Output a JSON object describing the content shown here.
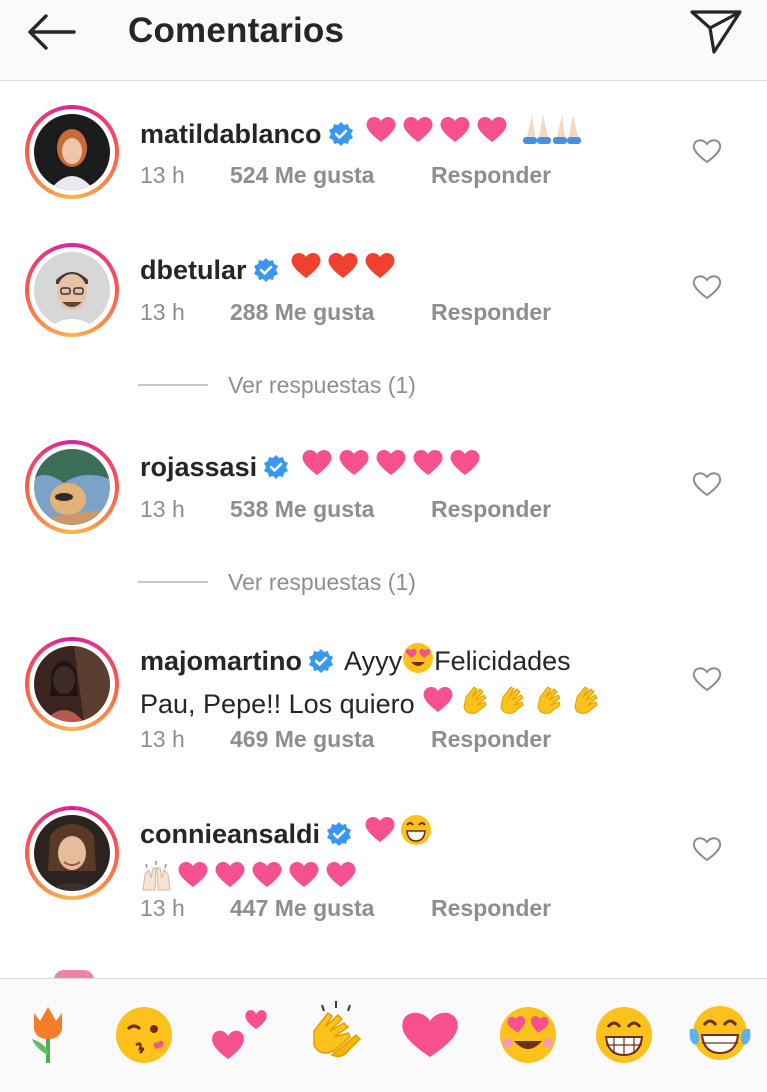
{
  "header": {
    "title": "Comentarios"
  },
  "comments": [
    {
      "username": "matildablanco",
      "verified": true,
      "text": "",
      "emojis": [
        "pink-heart",
        "pink-heart",
        "pink-heart",
        "pink-heart",
        "folded-hands",
        "folded-hands"
      ],
      "time": "13 h",
      "likes": "524 Me gusta",
      "reply": "Responder"
    },
    {
      "username": "dbetular",
      "verified": true,
      "text": "",
      "emojis": [
        "red-heart",
        "red-heart",
        "red-heart"
      ],
      "time": "13 h",
      "likes": "288 Me gusta",
      "reply": "Responder",
      "view_replies": "Ver respuestas (1)"
    },
    {
      "username": "rojassasi",
      "verified": true,
      "text": "",
      "emojis": [
        "pink-heart",
        "pink-heart",
        "pink-heart",
        "pink-heart",
        "pink-heart"
      ],
      "time": "13 h",
      "likes": "538 Me gusta",
      "reply": "Responder",
      "view_replies": "Ver respuestas (1)"
    },
    {
      "username": "majomartino",
      "verified": true,
      "text_part1": "Ayyy",
      "text_part2": "Felicidades",
      "text_line2": "Pau, Pepe!! Los quiero",
      "emojis": [
        "heart-eyes-face",
        "pink-heart",
        "clapping-hands",
        "clapping-hands",
        "clapping-hands",
        "clapping-hands"
      ],
      "time": "13 h",
      "likes": "469 Me gusta",
      "reply": "Responder"
    },
    {
      "username": "connieansaldi",
      "verified": true,
      "text": "",
      "emojis": [
        "pink-heart",
        "grinning-face",
        "raising-hands",
        "pink-heart",
        "pink-heart",
        "pink-heart",
        "pink-heart",
        "pink-heart"
      ],
      "time": "13 h",
      "likes": "447 Me gusta",
      "reply": "Responder"
    }
  ],
  "emoji_tray": [
    "tulip",
    "kissing-wink-face",
    "two-hearts",
    "clapping-hands",
    "pink-heart",
    "heart-eyes-face",
    "grinning-face",
    "tears-of-joy-face"
  ],
  "colors": {
    "pink_heart": "#f7508e",
    "red_heart": "#f0402e",
    "verified": "#3897f0",
    "muted": "#8e8e8e",
    "text": "#262626"
  }
}
